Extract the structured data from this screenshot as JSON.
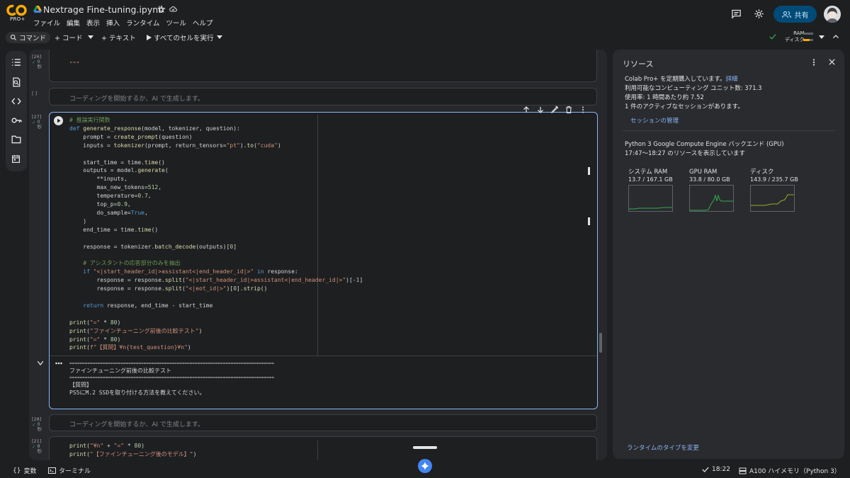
{
  "header": {
    "logo_badge": "PRO+",
    "title": "Nextrage Fine-tuning.ipynb",
    "menu": [
      "ファイル",
      "編集",
      "表示",
      "挿入",
      "ランタイム",
      "ツール",
      "ヘルプ"
    ],
    "share_label": "共有"
  },
  "toolbar": {
    "command_label": "コマンド",
    "code_label": "+ コード",
    "text_label": "+ テキスト",
    "run_all_label": "すべてのセルを実行",
    "ram_label": "RAM",
    "disk_label": "ディスク",
    "ram_fraction": 0.08,
    "disk_fraction": 0.61
  },
  "cells": {
    "c26_exec": "[26]",
    "c26_time": "0\n秒",
    "c26_code": "\"\"\"",
    "empty1_exec": "[ ]",
    "empty1_placeholder": "コーディングを開始するか、AI で生成します。",
    "c27_exec": "[27]",
    "c27_time": "0\n秒",
    "c28_exec": "[28]",
    "c28_time": "0\n秒",
    "c28_placeholder": "コーディングを開始するか、AI で生成します。",
    "c21_exec": "[21]",
    "c21_time": "8\n秒"
  },
  "output": {
    "line1": "================================================================================",
    "line2": "ファインチューニング前後の比較テスト",
    "line3": "================================================================================",
    "line4": "【質問】",
    "line5": "PS5にM.2 SSDを取り付ける方法を教えてください。"
  },
  "resources": {
    "title": "リソース",
    "subscription": "Colab Pro+ を定期購入しています。",
    "details_link": "詳細",
    "units": "利用可能なコンピューティング ユニット数: 371.3",
    "usage": "使用率: 1 時間あたり約 7.52",
    "sessions": "1 件のアクティブなセッションがあります。",
    "manage_sessions": "セッションの管理",
    "backend": "Python 3 Google Compute Engine バックエンド (GPU)",
    "range": "17:47〜18:27 のリソースを表示しています",
    "gauges": [
      {
        "label": "システム RAM",
        "value": "13.7 / 167.1 GB",
        "color": "#34a853"
      },
      {
        "label": "GPU RAM",
        "value": "33.8 / 80.0 GB",
        "color": "#34a853"
      },
      {
        "label": "ディスク",
        "value": "143.9 / 235.7 GB",
        "color": "#f9ab00"
      }
    ],
    "change_runtime": "ランタイムのタイプを変更"
  },
  "status": {
    "variables": "変数",
    "terminal": "ターミナル",
    "time": "18:22",
    "runtime": "A100 ハイメモリ（Python 3）"
  },
  "colors": {
    "accent": "#8ab4f8",
    "success": "#34a853",
    "warning": "#f9ab00",
    "share_bg": "#004a77"
  }
}
